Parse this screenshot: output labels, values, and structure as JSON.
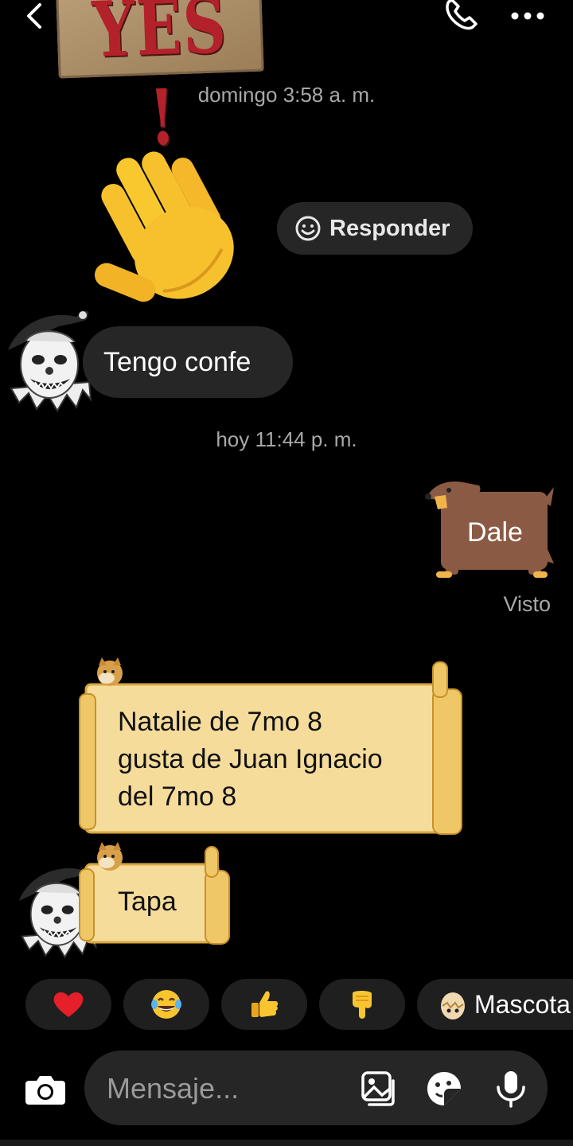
{
  "header": {
    "sticker_text": "YES !",
    "icons": {
      "back": "chevron-left-icon",
      "call": "phone-icon",
      "more": "more-horizontal-icon"
    }
  },
  "conversation": {
    "timestamp_1": "domingo 3:58 a. m.",
    "reply_button_label": "Responder",
    "message_1": "Tengo confe",
    "timestamp_2": "hoy 11:44 p. m.",
    "sent_message": "Dale",
    "seen_label": "Visto",
    "message_2": "Natalie de 7mo 8\ngusta de Juan Ignacio\ndel 7mo 8",
    "message_3": "Tapa"
  },
  "quick_reactions": {
    "items": [
      {
        "icon": "red-heart-icon",
        "emoji": "❤️"
      },
      {
        "icon": "laughing-tears-icon",
        "emoji": "😂"
      },
      {
        "icon": "thumbs-up-icon",
        "emoji": "👍"
      },
      {
        "icon": "pointing-down-icon",
        "emoji": "👇"
      }
    ],
    "pet_label": "Mascota"
  },
  "composer": {
    "placeholder": "Mensaje...",
    "icons": [
      "camera-icon",
      "gallery-icon",
      "sticker-icon",
      "microphone-icon"
    ]
  },
  "colors": {
    "background": "#000000",
    "bubble": "#262626",
    "scroll_paper": "#f6dc9a",
    "scroll_edge": "#d9a73e",
    "dog_brown": "#8a5a44",
    "timestamp_gray": "#a8a8a8"
  }
}
